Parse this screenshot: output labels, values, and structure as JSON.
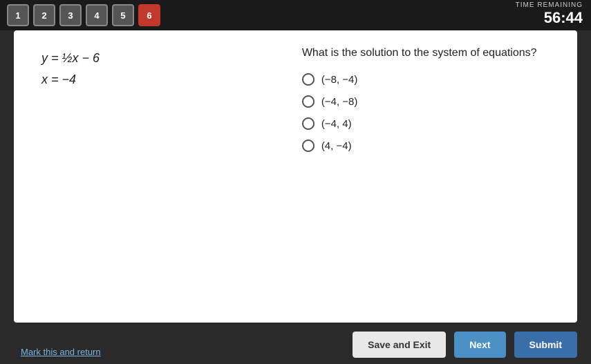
{
  "timer": {
    "label": "TIME REMAINING",
    "value": "56:44"
  },
  "questions": {
    "buttons": [
      {
        "number": "1",
        "active": false
      },
      {
        "number": "2",
        "active": false
      },
      {
        "number": "3",
        "active": false
      },
      {
        "number": "4",
        "active": false
      },
      {
        "number": "5",
        "active": false
      },
      {
        "number": "6",
        "active": true
      }
    ]
  },
  "equations": {
    "eq1": "y = ½x − 6",
    "eq2": "x = −4"
  },
  "question": {
    "text": "What is the solution to the system of equations?",
    "options": [
      {
        "label": "(−8, −4)"
      },
      {
        "label": "(−4, −8)"
      },
      {
        "label": "(−4, 4)"
      },
      {
        "label": "(4, −4)"
      }
    ]
  },
  "buttons": {
    "save_exit": "Save and Exit",
    "next": "Next",
    "submit": "Submit",
    "mark_return": "Mark this and return"
  }
}
